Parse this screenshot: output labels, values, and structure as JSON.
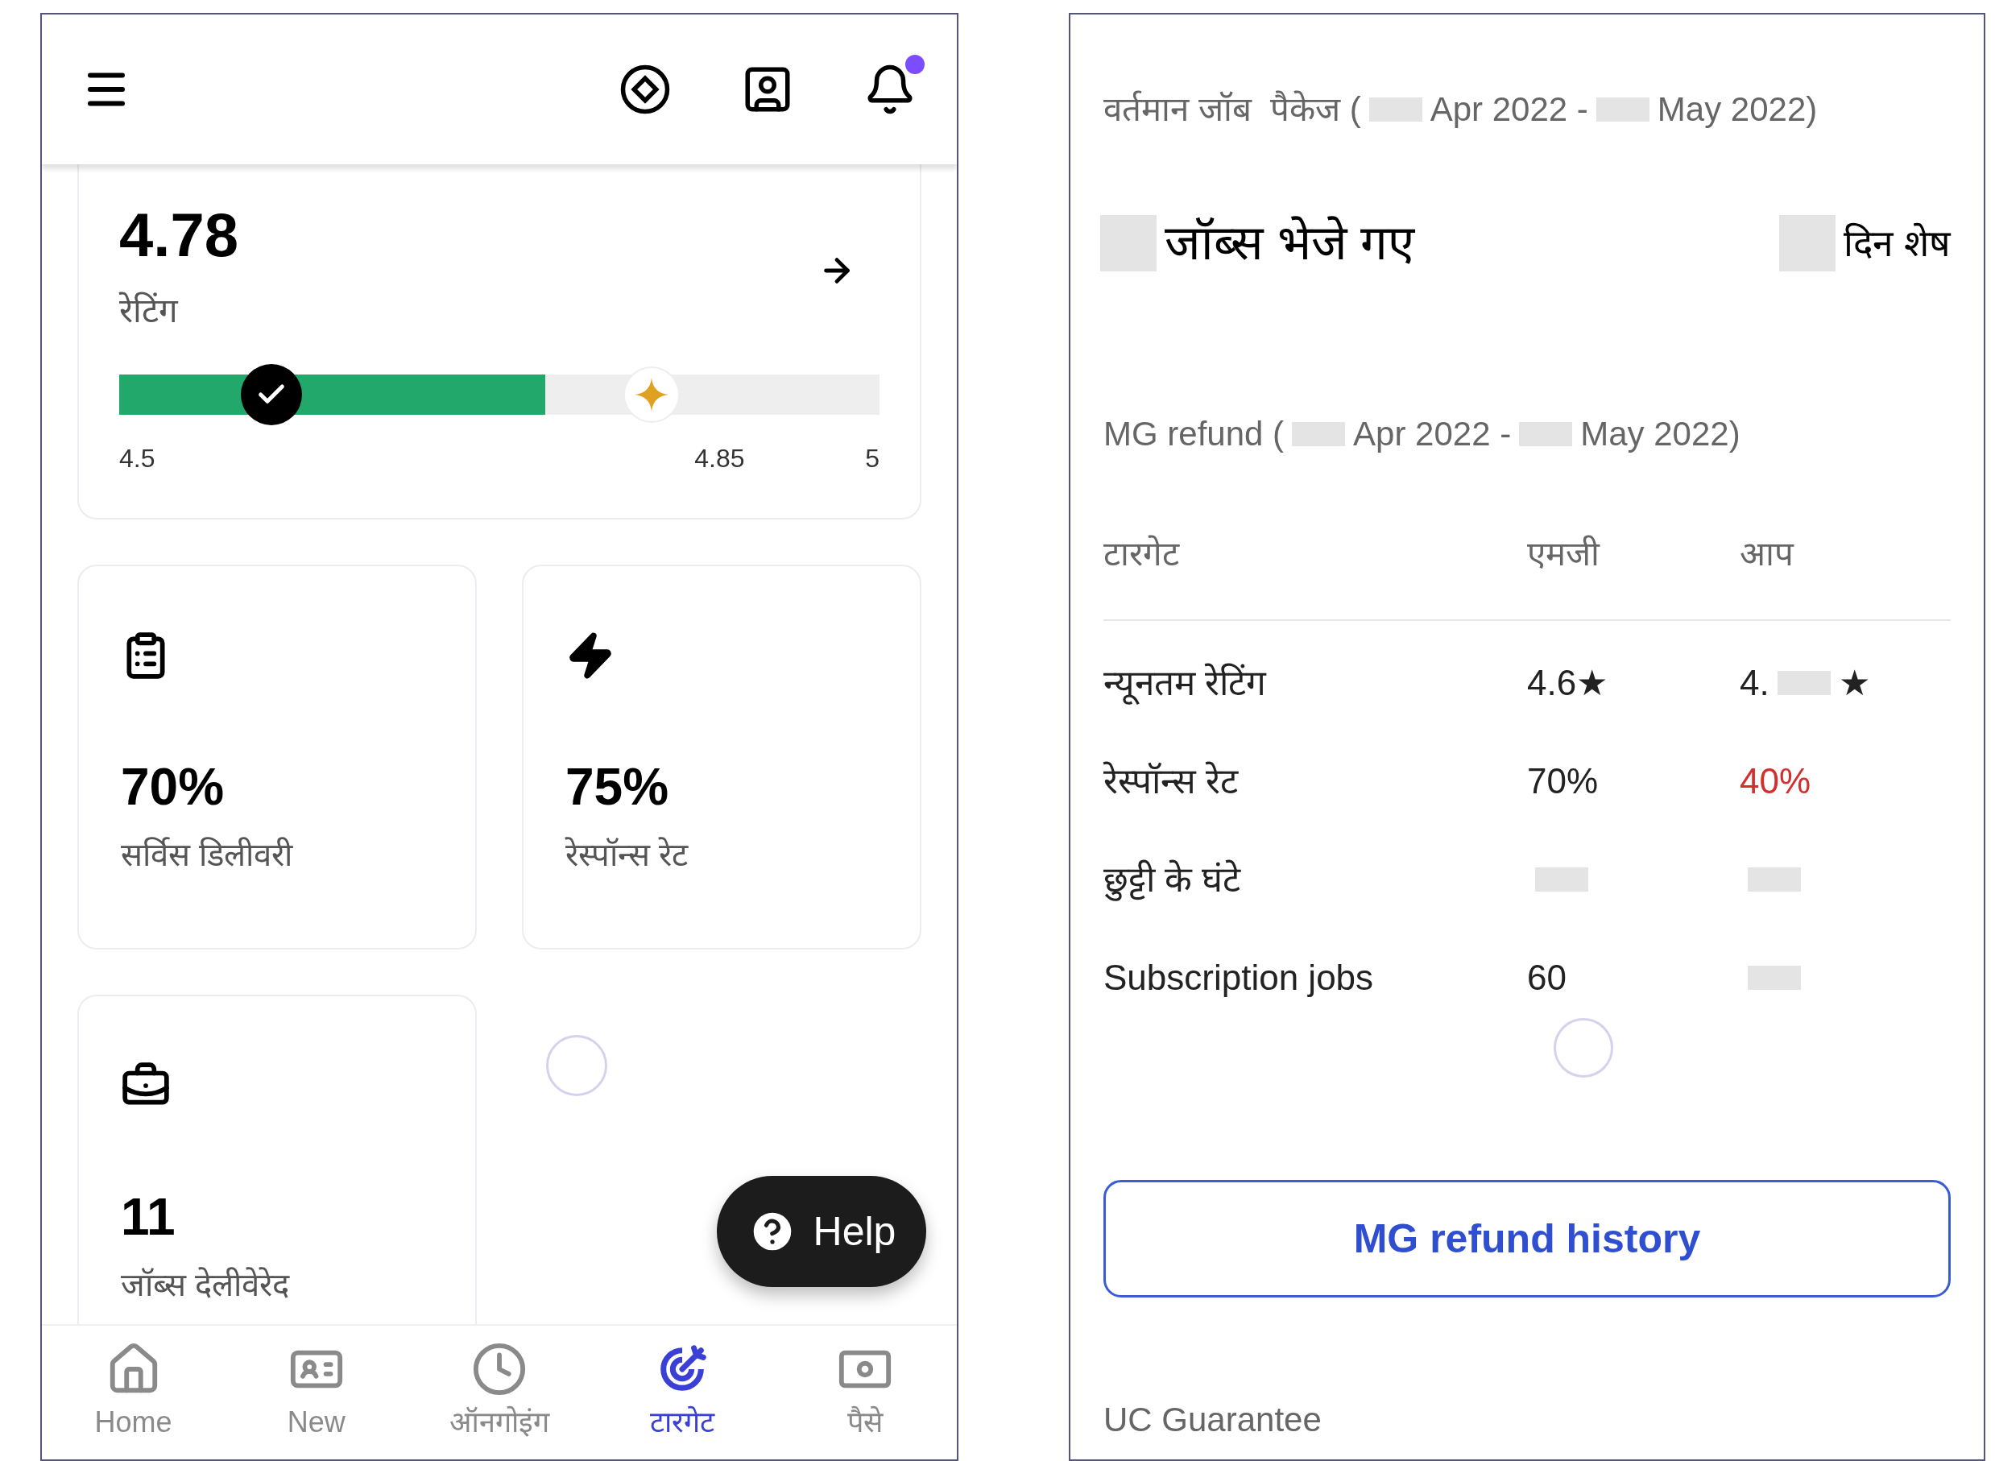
{
  "left_screen": {
    "header": {
      "notification_dot": true
    },
    "rating_card": {
      "value": "4.78",
      "label": "रेटिंग",
      "bar": {
        "level": 0.56,
        "markers": [
          {
            "kind": "achieved",
            "level": 0.2
          },
          {
            "kind": "target",
            "level": 0.7
          }
        ]
      },
      "ticks": [
        "4.5",
        "4.85",
        "5"
      ]
    },
    "stat_cards": [
      {
        "kind": "clipboard",
        "value": "70%",
        "label": "सर्विस डिलीवरी"
      },
      {
        "kind": "bolt",
        "value": "75%",
        "label": "रेस्पॉन्स रेट"
      },
      {
        "kind": "briefcase",
        "value": "11",
        "label": "जॉब्स देलीवेरेद"
      }
    ],
    "help_button": {
      "label": "Help"
    },
    "bottom_nav": [
      {
        "kind": "home",
        "label": "Home",
        "selected": false
      },
      {
        "kind": "card",
        "label": "New",
        "selected": false
      },
      {
        "kind": "clock",
        "label": "ऑनगोइंग",
        "selected": false
      },
      {
        "kind": "target",
        "label": "टारगेट",
        "selected": true
      },
      {
        "kind": "money",
        "label": "पैसे",
        "selected": false
      }
    ]
  },
  "right_screen": {
    "package_line": [
      {
        "kind": "text",
        "text": "वर्तमान जॉब  पैकेज ("
      },
      {
        "kind": "redacted"
      },
      {
        "kind": "text",
        "text": "Apr 2022 -"
      },
      {
        "kind": "redacted"
      },
      {
        "kind": "text",
        "text": "May 2022)"
      }
    ],
    "jobs_sent": [
      {
        "kind": "redacted"
      },
      {
        "kind": "text",
        "text": "जॉब्स भेजे गए"
      }
    ],
    "days_left": [
      {
        "kind": "redacted"
      },
      {
        "kind": "text",
        "text": "दिन शेष"
      }
    ],
    "mg_refund_title": [
      {
        "kind": "text",
        "text": "MG refund ("
      },
      {
        "kind": "redacted"
      },
      {
        "kind": "text",
        "text": "Apr 2022 -"
      },
      {
        "kind": "redacted"
      },
      {
        "kind": "text",
        "text": "May 2022)"
      }
    ],
    "table": {
      "columns": [
        "टारगेट",
        "एमजी",
        "आप"
      ],
      "rows": [
        [
          {
            "warning": false,
            "segments": [
              {
                "kind": "text",
                "text": "न्यूनतम रेटिंग"
              }
            ]
          },
          {
            "warning": false,
            "segments": [
              {
                "kind": "text",
                "text": "4.6★"
              }
            ]
          },
          {
            "warning": false,
            "segments": [
              {
                "kind": "text",
                "text": "4."
              },
              {
                "kind": "redacted"
              },
              {
                "kind": "text",
                "text": "★"
              }
            ]
          }
        ],
        [
          {
            "warning": false,
            "segments": [
              {
                "kind": "text",
                "text": "रेस्पॉन्स रेट"
              }
            ]
          },
          {
            "warning": false,
            "segments": [
              {
                "kind": "text",
                "text": "70%"
              }
            ]
          },
          {
            "warning": true,
            "segments": [
              {
                "kind": "text",
                "text": "40%"
              }
            ]
          }
        ],
        [
          {
            "warning": false,
            "segments": [
              {
                "kind": "text",
                "text": "छुट्टी के घंटे"
              }
            ]
          },
          {
            "warning": false,
            "segments": [
              {
                "kind": "redacted"
              }
            ]
          },
          {
            "warning": false,
            "segments": [
              {
                "kind": "redacted"
              }
            ]
          }
        ],
        [
          {
            "warning": false,
            "segments": [
              {
                "kind": "text",
                "text": "Subscription jobs"
              }
            ]
          },
          {
            "warning": false,
            "segments": [
              {
                "kind": "text",
                "text": "60"
              }
            ]
          },
          {
            "warning": false,
            "segments": [
              {
                "kind": "redacted"
              }
            ]
          }
        ]
      ]
    },
    "history_button": "MG refund history",
    "footer_title": "UC Guarantee"
  }
}
